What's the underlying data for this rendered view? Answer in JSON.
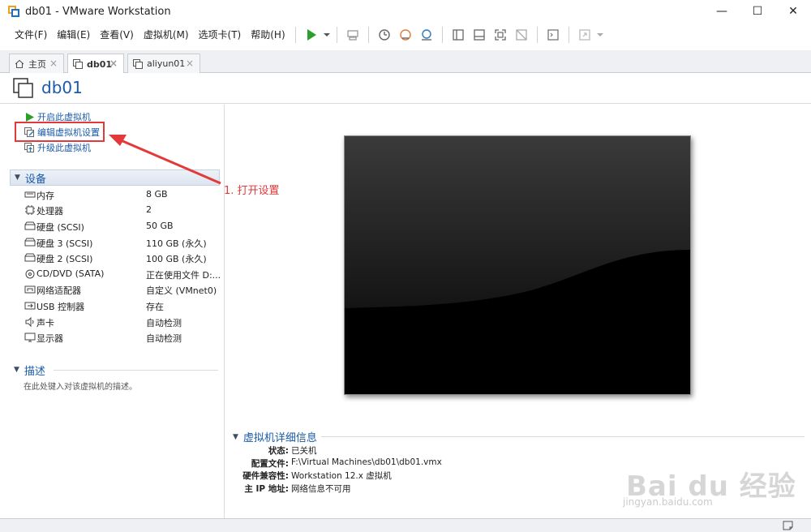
{
  "window": {
    "title": "db01 - VMware Workstation",
    "controls": {
      "minimize": "—",
      "maximize": "☐",
      "close": "✕"
    }
  },
  "menu": {
    "items": [
      "文件(F)",
      "编辑(E)",
      "查看(V)",
      "虚拟机(M)",
      "选项卡(T)",
      "帮助(H)"
    ]
  },
  "toolbar": {
    "icons": [
      "play-icon",
      "dropdown-icon",
      "send-keys-icon",
      "snapshot-icon",
      "revert-snapshot-icon",
      "snapshot-manager-icon",
      "library-view-icon",
      "console-view-icon",
      "fullscreen-icon",
      "unity-icon",
      "terminal-icon",
      "stretch-icon"
    ]
  },
  "tabs": [
    {
      "label": "主页",
      "icon": "home-icon",
      "close": "×"
    },
    {
      "label": "db01",
      "icon": "vm-icon",
      "close": "×"
    },
    {
      "label": "aliyun01",
      "icon": "vm-icon",
      "close": "×"
    }
  ],
  "vm": {
    "name": "db01"
  },
  "actions": [
    {
      "label": "开启此虚拟机",
      "icon": "power-on-icon"
    },
    {
      "label": "编辑虚拟机设置",
      "icon": "edit-settings-icon"
    },
    {
      "label": "升级此虚拟机",
      "icon": "upgrade-icon"
    }
  ],
  "devices_section": {
    "title": "设备",
    "items": [
      {
        "name": "内存",
        "value": "8 GB",
        "icon": "memory-icon"
      },
      {
        "name": "处理器",
        "value": "2",
        "icon": "cpu-icon"
      },
      {
        "name": "硬盘 (SCSI)",
        "value": "50 GB",
        "icon": "disk-icon"
      },
      {
        "name": "硬盘 3 (SCSI)",
        "value": "110 GB (永久)",
        "icon": "disk-icon"
      },
      {
        "name": "硬盘 2 (SCSI)",
        "value": "100 GB (永久)",
        "icon": "disk-icon"
      },
      {
        "name": "CD/DVD (SATA)",
        "value": "正在使用文件 D:...",
        "icon": "cd-icon"
      },
      {
        "name": "网络适配器",
        "value": "自定义 (VMnet0)",
        "icon": "network-icon"
      },
      {
        "name": "USB 控制器",
        "value": "存在",
        "icon": "usb-icon"
      },
      {
        "name": "声卡",
        "value": "自动检测",
        "icon": "sound-icon"
      },
      {
        "name": "显示器",
        "value": "自动检测",
        "icon": "monitor-icon"
      }
    ]
  },
  "description_section": {
    "title": "描述",
    "placeholder": "在此处键入对该虚拟机的描述。"
  },
  "details_section": {
    "title": "虚拟机详细信息",
    "rows": [
      {
        "key": "状态:",
        "value": "已关机"
      },
      {
        "key": "配置文件:",
        "value": "F:\\Virtual Machines\\db01\\db01.vmx"
      },
      {
        "key": "硬件兼容性:",
        "value": "Workstation 12.x 虚拟机"
      },
      {
        "key": "主 IP 地址:",
        "value": "网络信息不可用"
      }
    ]
  },
  "annotation": {
    "text": "1. 打开设置",
    "color": "#e23a3a"
  },
  "watermark": {
    "brand": "Bai du 经验",
    "url": "jingyan.baidu.com"
  },
  "colors": {
    "accent_blue": "#1a5aa8",
    "play_green": "#2aa02a",
    "annotation_red": "#e23a3a"
  }
}
